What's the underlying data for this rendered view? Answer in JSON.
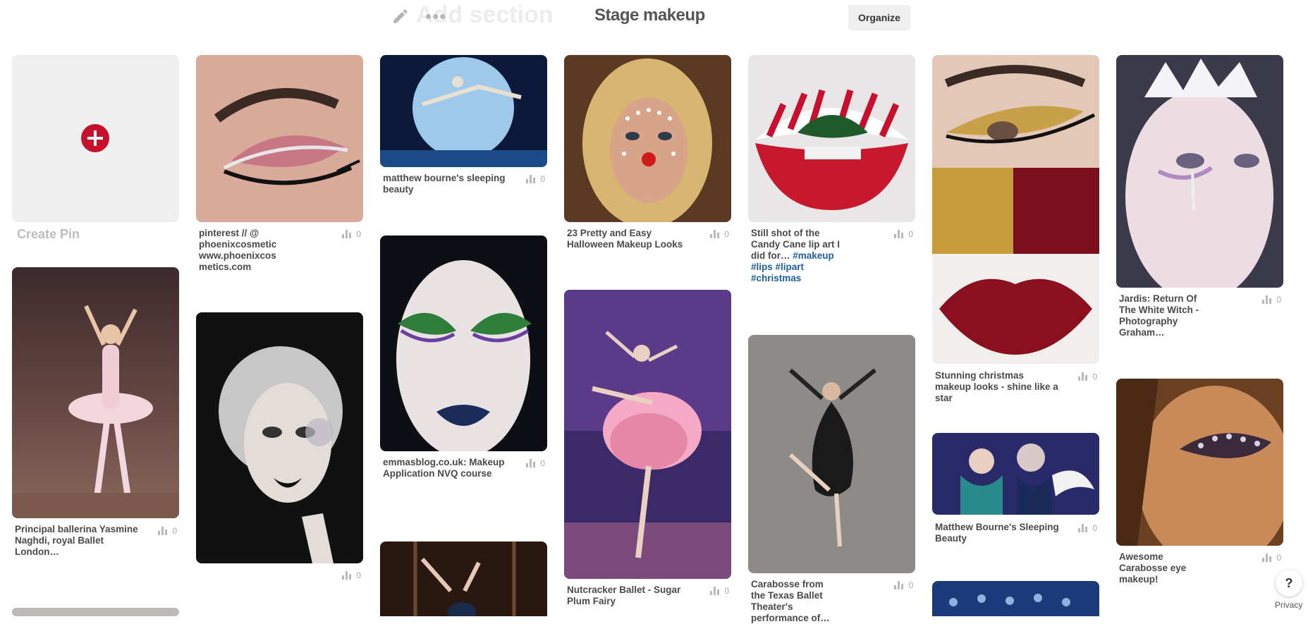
{
  "header": {
    "add_section_label": "Add section",
    "board_title": "Stage makeup",
    "organize_label": "Organize"
  },
  "create_pin": {
    "label": "Create Pin"
  },
  "pins": [
    {
      "id": "principal-ballerina",
      "description": "Principal ballerina Yasmine Naghdi, royal Ballet London…",
      "saves": "0",
      "image": "ballerina in pink tutu on stage"
    },
    {
      "id": "pink-glitter-eye",
      "description": "pinterest // @ phoenixcosmetic www.phoenixcos metics.com",
      "saves": "0",
      "image": "pink cut-crease eye makeup with glitter"
    },
    {
      "id": "silver-glitter-face",
      "description": "",
      "saves": "0",
      "image": "woman with silver glitter makeup and black lips"
    },
    {
      "id": "sleeping-beauty-jump",
      "description": "matthew bourne's sleeping beauty",
      "saves": "0",
      "image": "dancer leaping in front of large moon"
    },
    {
      "id": "green-eyeshadow",
      "description": "emmasblog.co.uk: Makeup Application NVQ course",
      "saves": "0",
      "image": "green eyeshadow with dark blue lips"
    },
    {
      "id": "reindeer-halloween",
      "description": "23 Pretty and Easy Halloween Makeup Looks",
      "saves": "0",
      "image": "reindeer face makeup with red nose"
    },
    {
      "id": "sugar-plum-fairy",
      "description": "Nutcracker Ballet - Sugar Plum Fairy",
      "saves": "0",
      "image": "ballerina in pink tutu arabesque"
    },
    {
      "id": "candy-cane-lips",
      "description": "Still shot of the Candy Cane lip art I did for…",
      "tags": "#makeup #lips #lipart #christmas",
      "saves": "0",
      "image": "candy cane lip art"
    },
    {
      "id": "carabosse-texas",
      "description": "Carabosse from the Texas Ballet Theater's performance of…",
      "saves": "0",
      "image": "dancer in black feathered costume"
    },
    {
      "id": "christmas-star",
      "description": "Stunning christmas makeup looks - shine like a star",
      "saves": "0",
      "image": "gold glitter eye and red matte lips collage"
    },
    {
      "id": "bourne-sleeping-beauty",
      "description": "Matthew Bourne's Sleeping Beauty",
      "saves": "0",
      "image": "two dancers, one with white wings"
    },
    {
      "id": "white-witch",
      "description": "Jardis: Return Of The White Witch - Photography Graham…",
      "saves": "0",
      "image": "white witch ice crown makeup"
    },
    {
      "id": "carabosse-eye",
      "description": "Awesome Carabosse eye makeup!",
      "saves": "0",
      "image": "jeweled eye makeup"
    }
  ],
  "help_label": "?",
  "privacy_label": "Privacy"
}
